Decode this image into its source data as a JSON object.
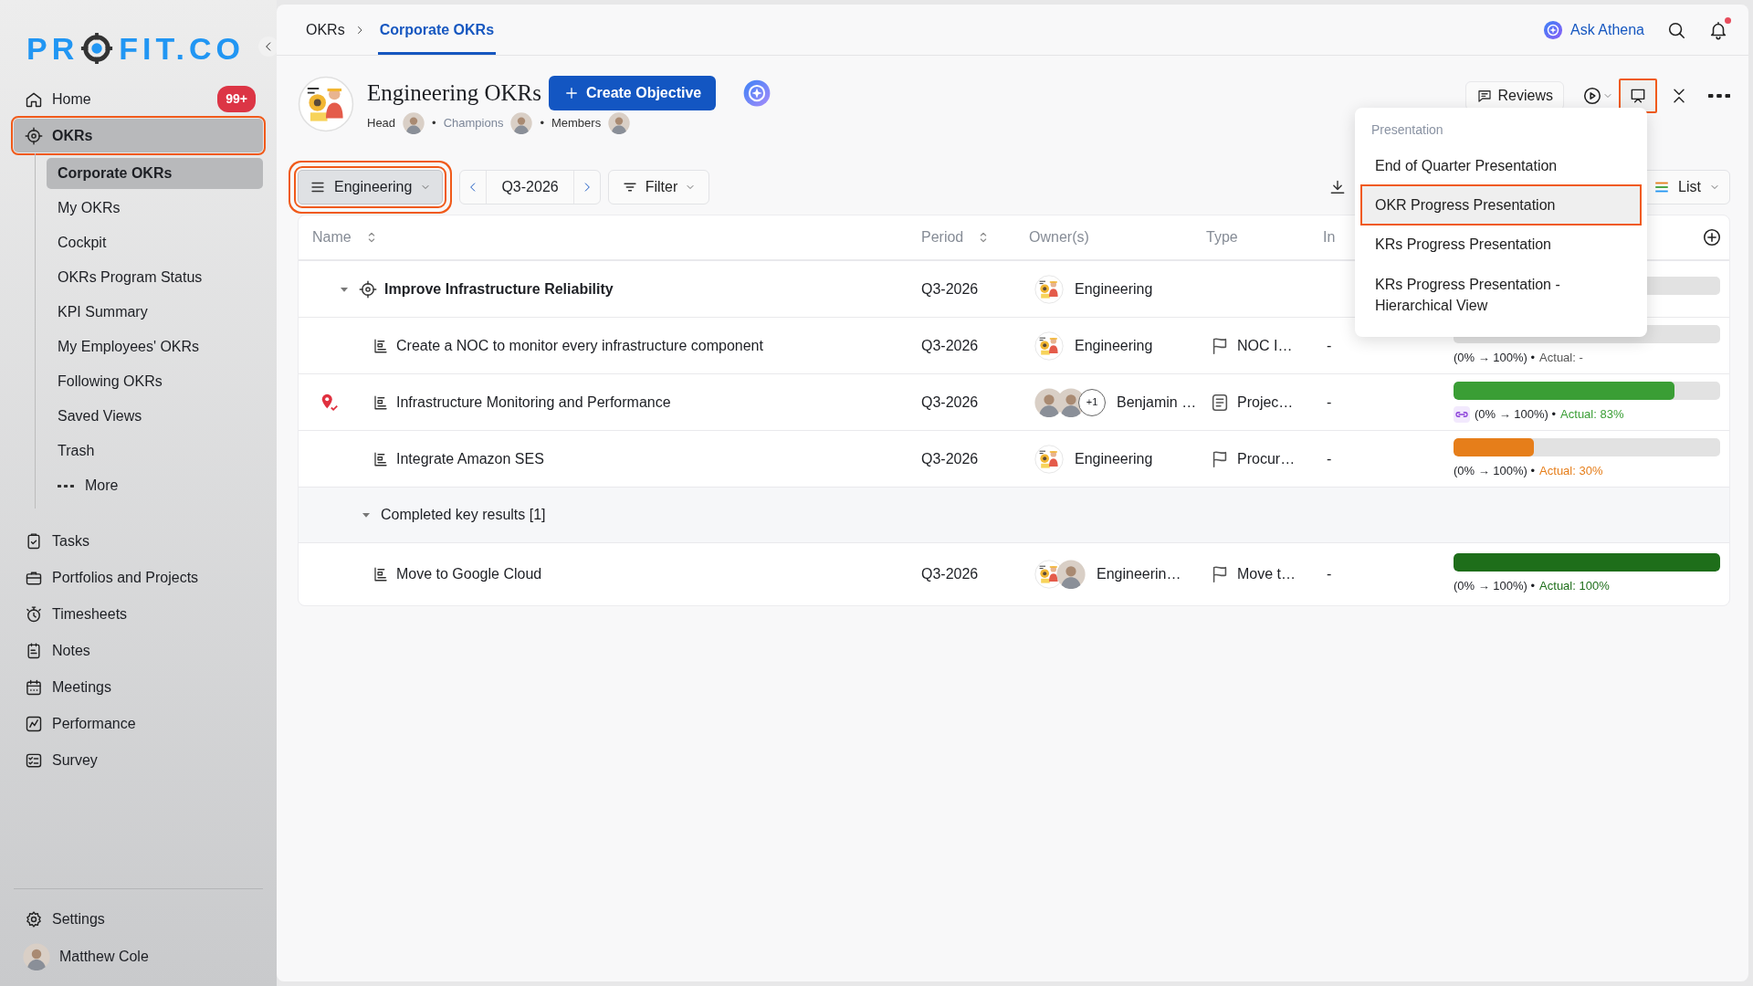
{
  "sidebar": {
    "logo_start": "PR",
    "logo_end": "FIT.CO",
    "items": [
      {
        "label": "Home",
        "badge": "99+",
        "selected": false,
        "highlighted": false
      },
      {
        "label": "OKRs",
        "selected": true,
        "highlighted": true,
        "children": [
          {
            "label": "Corporate OKRs",
            "kind": "link",
            "selected": true
          },
          {
            "label": "My OKRs",
            "kind": "link",
            "selected": false
          },
          {
            "label": "Cockpit",
            "kind": "link",
            "selected": false
          },
          {
            "label": "OKRs Program Status",
            "kind": "link",
            "selected": false
          },
          {
            "label": "KPI Summary",
            "kind": "link",
            "selected": false
          },
          {
            "label": "My Employees' OKRs",
            "kind": "link",
            "selected": false
          },
          {
            "label": "Following OKRs",
            "kind": "link",
            "selected": false
          },
          {
            "label": "Saved Views",
            "kind": "link",
            "selected": false
          },
          {
            "label": "Trash",
            "kind": "link",
            "selected": false
          },
          {
            "label": "More",
            "kind": "more",
            "selected": false
          }
        ]
      },
      {
        "label": "Tasks",
        "selected": false,
        "highlighted": false
      },
      {
        "label": "Portfolios and Projects",
        "selected": false,
        "highlighted": false
      },
      {
        "label": "Timesheets",
        "selected": false,
        "highlighted": false
      },
      {
        "label": "Notes",
        "selected": false,
        "highlighted": false
      },
      {
        "label": "Meetings",
        "selected": false,
        "highlighted": false
      },
      {
        "label": "Performance",
        "selected": false,
        "highlighted": false
      },
      {
        "label": "Survey",
        "selected": false,
        "highlighted": false
      }
    ],
    "settings": "Settings",
    "user": "Matthew Cole"
  },
  "topbar": {
    "breadcrumb": [
      {
        "label": "OKRs",
        "selected": false
      },
      {
        "label": "Corporate OKRs",
        "selected": true
      }
    ],
    "ask": "Ask Athena",
    "unread": true
  },
  "header": {
    "title": "Engineering OKRs",
    "create": "Create Objective",
    "roles": [
      {
        "label": "Head",
        "muted": false
      },
      {
        "label": "Champions",
        "muted": true,
        "separator": "•"
      },
      {
        "label": "Members",
        "muted": false,
        "separator": "•"
      }
    ],
    "reviews": "Reviews",
    "presentation_highlighted": true
  },
  "toolbar": {
    "team": "Engineering",
    "team_highlighted": true,
    "period": "Q3-2026",
    "filter": "Filter",
    "view": "List"
  },
  "table": {
    "columns": [
      {
        "label": "Name",
        "sortable": true
      },
      {
        "label": "Period",
        "sortable": true
      },
      {
        "label": "Owner(s)",
        "sortable": false
      },
      {
        "label": "Type",
        "sortable": false
      },
      {
        "label": "In",
        "sortable": false
      }
    ],
    "rows": [
      {
        "kind": "objective",
        "name": "Improve Infrastructure Reliability",
        "expanded": true,
        "period": "Q3-2026",
        "owners": {
          "name": "Engineering",
          "avatars": [
            {
              "kind": "team"
            }
          ]
        },
        "progress": {}
      },
      {
        "kind": "key_result",
        "name": "Create a NOC to monitor every infrastructure component",
        "marked": false,
        "period": "Q3-2026",
        "owners": {
          "name": "Engineering",
          "avatars": [
            {
              "kind": "team"
            }
          ]
        },
        "type": {
          "kind": "flag",
          "label": "NOC I…"
        },
        "initiative": "-",
        "progress": {
          "level": 0,
          "range": "(0% → 100%) •",
          "actual": "Actual: -",
          "color": "#555555",
          "linked": false
        }
      },
      {
        "kind": "key_result",
        "name": "Infrastructure Monitoring and Performance",
        "marked": true,
        "period": "Q3-2026",
        "owners": {
          "name": "Benjamin …",
          "avatars": [
            {
              "kind": "person"
            },
            {
              "kind": "person"
            }
          ],
          "more": "+1"
        },
        "type": {
          "kind": "document",
          "label": "Projec…"
        },
        "initiative": "-",
        "progress": {
          "level": 0.83,
          "range": "(0% → 100%) •",
          "actual": "Actual: 83%",
          "color": "#3a9e35",
          "linked": true
        }
      },
      {
        "kind": "key_result",
        "name": "Integrate Amazon SES",
        "marked": false,
        "period": "Q3-2026",
        "owners": {
          "name": "Engineering",
          "avatars": [
            {
              "kind": "team"
            }
          ]
        },
        "type": {
          "kind": "flag",
          "label": "Procur…"
        },
        "initiative": "-",
        "progress": {
          "level": 0.3,
          "range": "(0% → 100%) •",
          "actual": "Actual: 30%",
          "color": "#e67e1a",
          "linked": false
        }
      },
      {
        "kind": "group",
        "name": "Completed key results [1]",
        "expanded": true
      },
      {
        "kind": "key_result",
        "name": "Move to Google Cloud",
        "marked": false,
        "period": "Q3-2026",
        "owners": {
          "name": "Engineerin…",
          "avatars": [
            {
              "kind": "team"
            },
            {
              "kind": "person"
            }
          ]
        },
        "type": {
          "kind": "flag",
          "label": "Move t…"
        },
        "initiative": "-",
        "progress": {
          "level": 1,
          "range": "(0% → 100%) •",
          "actual": "Actual: 100%",
          "color": "#1e6e1a",
          "linked": false
        }
      }
    ]
  },
  "menu": {
    "heading": "Presentation",
    "items": [
      {
        "label": "End of Quarter Presentation",
        "selected": false,
        "highlighted": false
      },
      {
        "label": "OKR Progress Presentation",
        "selected": true,
        "highlighted": true
      },
      {
        "label": "KRs Progress Presentation",
        "selected": false,
        "highlighted": false
      },
      {
        "label": "KRs Progress Presentation - Hierarchical View",
        "selected": false,
        "highlighted": false
      }
    ]
  }
}
